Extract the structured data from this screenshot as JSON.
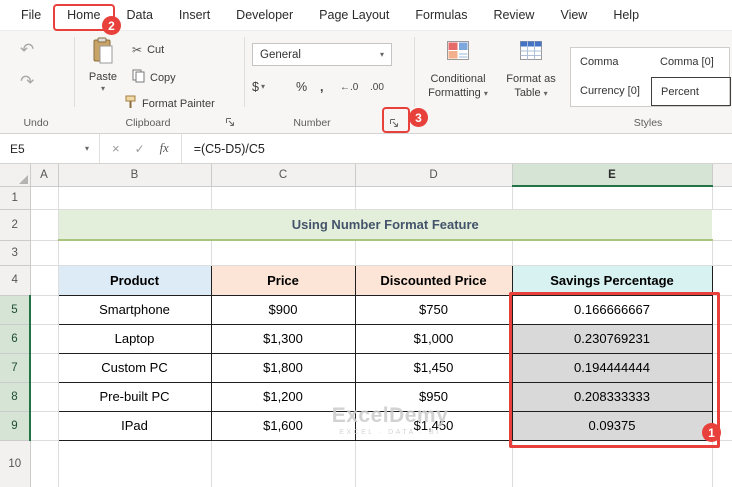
{
  "menu": {
    "tabs": [
      "File",
      "Home",
      "Data",
      "Insert",
      "Developer",
      "Page Layout",
      "Formulas",
      "Review",
      "View",
      "Help"
    ]
  },
  "ribbon": {
    "undo_group": {
      "label": "Undo",
      "undo_glyph": "↶",
      "redo_glyph": "↷"
    },
    "clipboard_group": {
      "label": "Clipboard",
      "paste_label": "Paste",
      "cut_label": "Cut",
      "copy_label": "Copy",
      "format_painter_label": "Format Painter"
    },
    "number_group": {
      "label": "Number",
      "format_value": "General",
      "currency_symbol": "$",
      "percent_symbol": "%",
      "comma_symbol": ",",
      "increase_decimal_glyph": "←.0",
      "decrease_decimal_glyph": ".00"
    },
    "styles_group": {
      "label": "Styles",
      "conditional_formatting_line1": "Conditional",
      "conditional_formatting_line2": "Formatting",
      "format_as_table_line1": "Format as",
      "format_as_table_line2": "Table",
      "gallery": [
        "Comma",
        "Comma [0]",
        "Currency [0]",
        "Percent"
      ],
      "selected_style": "Percent"
    }
  },
  "formula_bar": {
    "name_box": "E5",
    "cancel_glyph": "×",
    "enter_glyph": "✓",
    "fx_glyph": "fx",
    "formula": "=(C5-D5)/C5"
  },
  "sheet": {
    "column_headers": [
      "A",
      "B",
      "C",
      "D",
      "E"
    ],
    "row_numbers": [
      "1",
      "2",
      "3",
      "4",
      "5",
      "6",
      "7",
      "8",
      "9",
      "10"
    ],
    "title": "Using Number Format Feature",
    "table": {
      "headers": [
        "Product",
        "Price",
        "Discounted Price",
        "Savings Percentage"
      ],
      "rows": [
        [
          "Smartphone",
          "$900",
          "$750",
          "0.166666667"
        ],
        [
          "Laptop",
          "$1,300",
          "$1,000",
          "0.230769231"
        ],
        [
          "Custom PC",
          "$1,800",
          "$1,450",
          "0.194444444"
        ],
        [
          "Pre-built PC",
          "$1,200",
          "$950",
          "0.208333333"
        ],
        [
          "IPad",
          "$1,600",
          "$1,450",
          "0.09375"
        ]
      ]
    },
    "selection": {
      "active_cell": "E5",
      "range": "E5:E9"
    }
  },
  "watermark": {
    "line1": "ExcelDemy",
    "line2": "EXCEL · DATA · BI"
  },
  "annotations": {
    "step1": "1",
    "step2": "2",
    "step3": "3"
  },
  "colors": {
    "annotation_red": "#e8403a",
    "excel_green": "#217346",
    "title_fill": "#e3efdb",
    "header_blue": "#ddebf7",
    "header_peach": "#fce4d6",
    "header_cyan": "#d7f2f0",
    "selection_gray": "#d9d9d9"
  }
}
